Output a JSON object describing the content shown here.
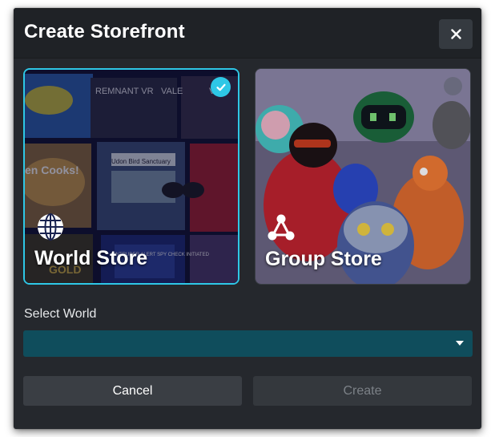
{
  "dialog": {
    "title": "Create Storefront",
    "close_icon": "close-icon"
  },
  "options": [
    {
      "label": "World Store",
      "icon": "globe-icon",
      "selected": true
    },
    {
      "label": "Group Store",
      "icon": "group-nodes-icon",
      "selected": false
    }
  ],
  "world_card_art": {
    "tiles": [
      "REMNANT VR",
      "VALE",
      "VR",
      "Udon Bird Sanctuary",
      "en Cooks!",
      "INTRUDER ALERT SPY CHECK INITIATED",
      "GOLD"
    ]
  },
  "select": {
    "label": "Select World",
    "value": "",
    "caret_icon": "caret-down-icon"
  },
  "buttons": {
    "cancel": "Cancel",
    "create": "Create"
  },
  "colors": {
    "accent": "#2ec7e6",
    "dialog_bg": "#25282d",
    "select_bg": "#0f4d5c"
  }
}
